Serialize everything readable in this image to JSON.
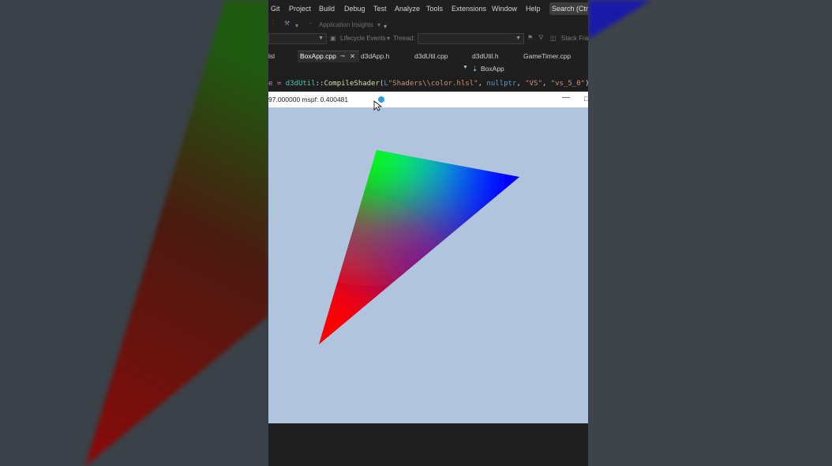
{
  "menubar": {
    "items": [
      "Git",
      "Project",
      "Build",
      "Debug",
      "Test",
      "Analyze",
      "Tools",
      "Extensions",
      "Window",
      "Help"
    ],
    "search_label": "Search (Ctrl+"
  },
  "toolbar": {
    "app_insights": "Application Insights",
    "lifecycle_events": "Lifecycle Events",
    "thread_label": "Thread:",
    "stack_frame": "Stack Fra"
  },
  "tabs": [
    {
      "label": "lsl"
    },
    {
      "label": "BoxApp.cpp",
      "active": true
    },
    {
      "label": "d3dApp.h"
    },
    {
      "label": "d3dUtil.cpp"
    },
    {
      "label": "d3dUtil.h"
    },
    {
      "label": "GameTimer.cpp"
    }
  ],
  "navbar": {
    "member": "BoxApp"
  },
  "code": {
    "prefix": "e = ",
    "class_name": "d3dUtil",
    "sep": "::",
    "func": "CompileShader",
    "open": "(",
    "string_prefix": "L",
    "path": "\"Shaders\\\\color.hlsl\"",
    "comma1": ", ",
    "nullptr": "nullptr",
    "comma2": ", ",
    "vs": "\"VS\"",
    "comma3": ", ",
    "target": "\"vs_5_0\"",
    "close": ");"
  },
  "app_window": {
    "title": "97.000000   mspf: 0.400481",
    "minimize": "—",
    "extra": "□",
    "background": "#b0c4de"
  },
  "triangle": {
    "vertices": [
      {
        "color": "#ff0000"
      },
      {
        "color": "#00ff00"
      },
      {
        "color": "#0000ff"
      }
    ]
  },
  "colors": {
    "vs_background": "#1f1f1f",
    "accent": "#0078d4"
  }
}
